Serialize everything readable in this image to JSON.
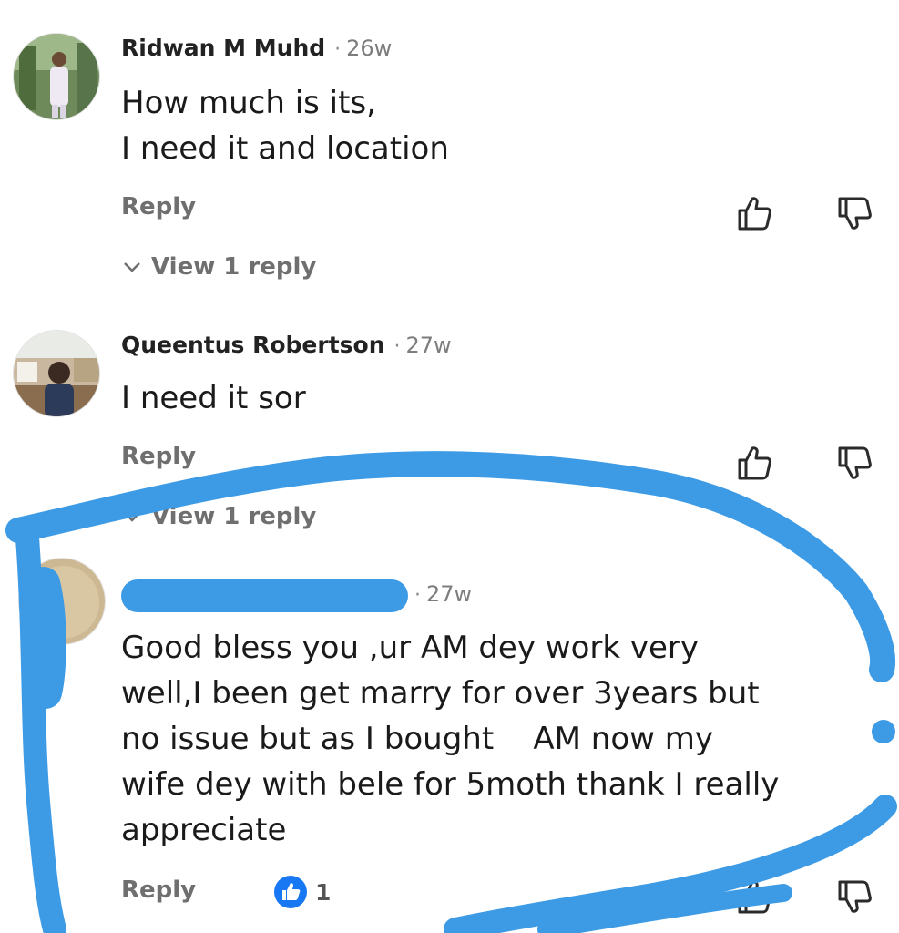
{
  "comments": [
    {
      "author": "Ridwan M Muhd",
      "separator": "·",
      "time": "26w",
      "text_lines": [
        "How much is its,",
        "I need it and location"
      ],
      "reply_label": "Reply",
      "view_replies_label": "View 1 reply"
    },
    {
      "author": "Queentus Robertson",
      "separator": "·",
      "time": "27w",
      "text_lines": [
        "I need it sor"
      ],
      "reply_label": "Reply",
      "view_replies_label": "View 1 reply"
    },
    {
      "author": "",
      "separator": "·",
      "time": "27w",
      "text_lines": [
        "Good bless you ,ur AM dey work very",
        "well,I been get marry for over 3years but",
        "no issue but as I bought    AM now my",
        "wife dey with bele for 5moth thank I really",
        "appreciate"
      ],
      "reply_label": "Reply",
      "like_count": "1"
    }
  ],
  "icons": {
    "like": "thumbs-up-icon",
    "dislike": "thumbs-down-icon",
    "expand": "chevron-down-icon",
    "liked_badge": "liked-badge-icon"
  },
  "colors": {
    "scribble": "#3d9be6",
    "like_badge": "#1877f2",
    "muted_text": "#6f6f6f"
  }
}
